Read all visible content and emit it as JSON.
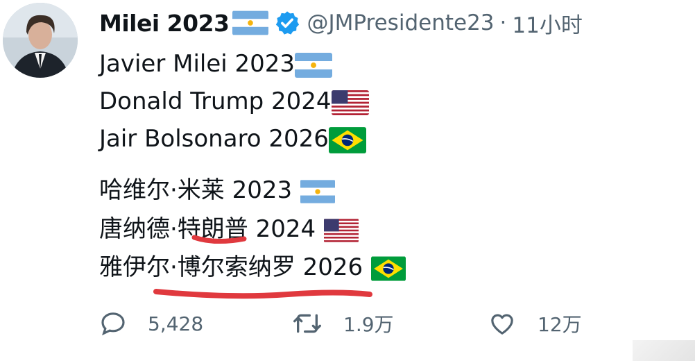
{
  "tweet": {
    "display_name": "Milei 2023",
    "handle": "@JMPresidente23",
    "separator": "·",
    "time": "11小时",
    "lines": [
      "Javier Milei 2023",
      "Donald Trump 2024",
      "Jair Bolsonaro 2026",
      "哈维尔·米莱 2023",
      "唐纳德·特朗普 2024",
      "雅伊尔·博尔索纳罗 2026"
    ],
    "flags": [
      "argentina-flag-icon",
      "usa-flag-icon",
      "brazil-flag-icon",
      "argentina-flag-icon",
      "usa-flag-icon",
      "brazil-flag-icon"
    ]
  },
  "actions": {
    "replies": "5,428",
    "retweets": "1.9万",
    "likes": "12万"
  },
  "colors": {
    "verified": "#1d9bf0",
    "text": "#0f1419",
    "muted": "#536471",
    "underline": "#e0393e"
  }
}
